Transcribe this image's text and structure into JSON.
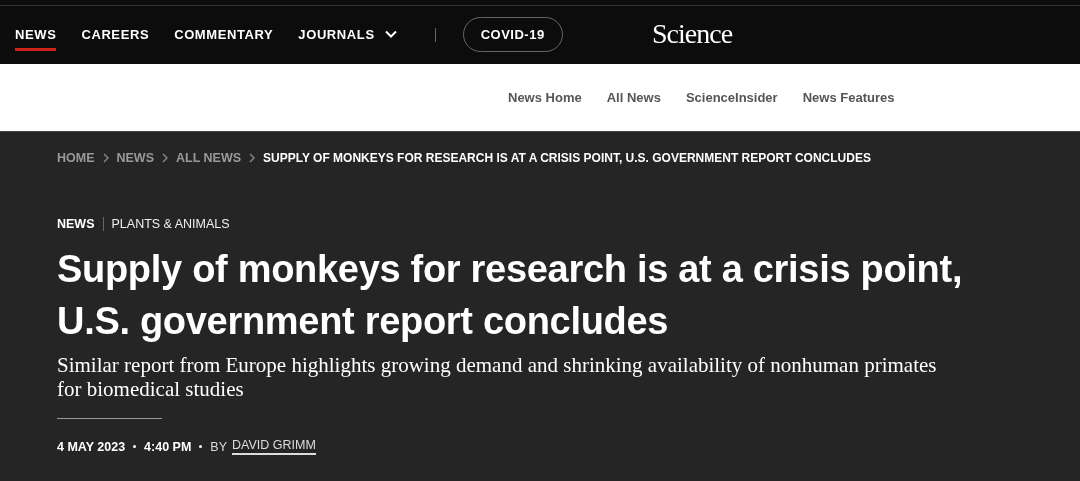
{
  "top_nav": {
    "items": [
      {
        "label": "NEWS",
        "selected": true,
        "kind": "link"
      },
      {
        "label": "CAREERS",
        "selected": false,
        "kind": "link"
      },
      {
        "label": "COMMENTARY",
        "selected": false,
        "kind": "link"
      },
      {
        "label": "JOURNALS",
        "selected": false,
        "kind": "dropdown"
      },
      {
        "label": "COVID-19",
        "selected": false,
        "kind": "pill"
      }
    ],
    "logo": "Science"
  },
  "sub_nav": [
    "News Home",
    "All News",
    "ScienceInsider",
    "News Features"
  ],
  "breadcrumb": [
    {
      "label": "HOME",
      "current": false
    },
    {
      "label": "NEWS",
      "current": false
    },
    {
      "label": "ALL NEWS",
      "current": false
    },
    {
      "label": "SUPPLY OF MONKEYS FOR RESEARCH IS AT A CRISIS POINT, U.S. GOVERNMENT REPORT CONCLUDES",
      "current": true
    }
  ],
  "article": {
    "section": "NEWS",
    "topic": "PLANTS & ANIMALS",
    "headline": "Supply of monkeys for research is at a crisis point, U.S. government report concludes",
    "subtitle": "Similar report from Europe highlights growing demand and shrinking availability of nonhuman primates for biomedical studies",
    "date": "4 MAY 2023",
    "time": "4:40 PM",
    "by": "BY",
    "author": "DAVID GRIMM"
  }
}
